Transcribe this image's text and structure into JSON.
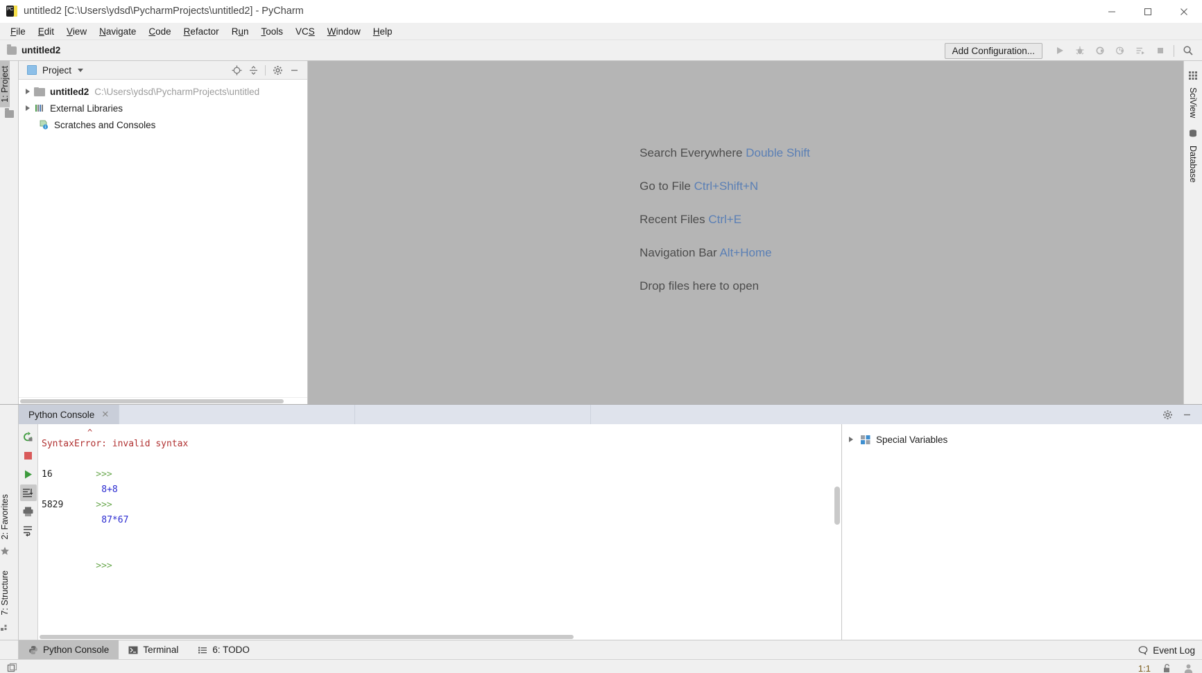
{
  "window": {
    "title": "untitled2 [C:\\Users\\ydsd\\PycharmProjects\\untitled2] - PyCharm",
    "app_icon": "pycharm-icon",
    "controls": {
      "minimize": "—",
      "maximize": "□",
      "close": "✕"
    }
  },
  "menubar": {
    "items": [
      {
        "label": "File",
        "mnemonic": "F"
      },
      {
        "label": "Edit",
        "mnemonic": "E"
      },
      {
        "label": "View",
        "mnemonic": "V"
      },
      {
        "label": "Navigate",
        "mnemonic": "N"
      },
      {
        "label": "Code",
        "mnemonic": "C"
      },
      {
        "label": "Refactor",
        "mnemonic": "R"
      },
      {
        "label": "Run",
        "mnemonic": "u"
      },
      {
        "label": "Tools",
        "mnemonic": "T"
      },
      {
        "label": "VCS",
        "mnemonic": "S"
      },
      {
        "label": "Window",
        "mnemonic": "W"
      },
      {
        "label": "Help",
        "mnemonic": "H"
      }
    ]
  },
  "navbar": {
    "breadcrumb": "untitled2",
    "folder_icon": "folder-icon",
    "add_configuration_label": "Add Configuration...",
    "toolbar_icons": [
      "run-icon",
      "debug-icon",
      "run-coverage-icon",
      "profile-icon",
      "run-with-params-icon",
      "stop-icon",
      "search-icon"
    ]
  },
  "left_rail": {
    "top_tabs": [
      {
        "label": "1: Project",
        "icon": "project-icon",
        "active": true
      }
    ],
    "bottom_tabs": [
      {
        "label": "2: Favorites",
        "icon": "star-icon"
      },
      {
        "label": "7: Structure",
        "icon": "structure-icon"
      }
    ]
  },
  "right_rail": {
    "tabs": [
      {
        "label": "SciView",
        "icon": "grid-icon"
      },
      {
        "label": "Database",
        "icon": "database-icon"
      }
    ]
  },
  "project_panel": {
    "title": "Project",
    "dropdown_icon": "chevron-down-icon",
    "actions": [
      "locate-icon",
      "collapse-all-icon",
      "gear-icon",
      "minimize-icon"
    ],
    "tree": [
      {
        "name": "untitled2",
        "path": "C:\\Users\\ydsd\\PycharmProjects\\untitled",
        "icon": "folder-icon",
        "expandable": true
      },
      {
        "name": "External Libraries",
        "path": "",
        "icon": "libraries-icon",
        "expandable": true
      },
      {
        "name": "Scratches and Consoles",
        "path": "",
        "icon": "scratches-icon",
        "expandable": false
      }
    ]
  },
  "editor": {
    "welcome_rows": [
      {
        "action": "Search Everywhere",
        "shortcut": "Double Shift"
      },
      {
        "action": "Go to File",
        "shortcut": "Ctrl+Shift+N"
      },
      {
        "action": "Recent Files",
        "shortcut": "Ctrl+E"
      },
      {
        "action": "Navigation Bar",
        "shortcut": "Alt+Home"
      },
      {
        "action": "Drop files here to open",
        "shortcut": ""
      }
    ]
  },
  "console": {
    "tab_label": "Python Console",
    "tab_close_icon": "close-icon",
    "header_actions": [
      "gear-icon",
      "minimize-icon"
    ],
    "toolstrip_icons": [
      "rerun-icon",
      "stop-icon",
      "execute-icon",
      "scroll-to-end-icon",
      "print-icon",
      "soft-wrap-icon"
    ],
    "lines": [
      {
        "type": "caret",
        "text": "^"
      },
      {
        "type": "error",
        "text": "SyntaxError: invalid syntax"
      },
      {
        "type": "input",
        "prompt": ">>>",
        "code": "8+8"
      },
      {
        "type": "output",
        "text": "16"
      },
      {
        "type": "input",
        "prompt": ">>>",
        "code": "87*67"
      },
      {
        "type": "output",
        "text": "5829"
      },
      {
        "type": "input",
        "prompt": ">>>",
        "code": ""
      }
    ],
    "variables": {
      "label": "Special Variables",
      "icon": "variables-icon",
      "expand_icon": "chevron-right-icon"
    }
  },
  "bottom_tools": {
    "tabs": [
      {
        "label": "Python Console",
        "icon": "python-icon",
        "active": true
      },
      {
        "label": "Terminal",
        "icon": "terminal-icon",
        "active": false
      },
      {
        "label": "6: TODO",
        "icon": "todo-icon",
        "active": false
      }
    ],
    "event_log": {
      "label": "Event Log",
      "icon": "balloon-icon"
    }
  },
  "statusbar": {
    "left_icon": "toggle-layout-icon",
    "position": "1:1",
    "lock_icon": "lock-open-icon",
    "user_icon": "person-icon"
  },
  "colors": {
    "accent_blue": "#2a2ad0",
    "prompt_green": "#6aa84f",
    "error_red": "#b03030",
    "shortcut_blue": "#5a7fb5",
    "editor_bg": "#b5b5b5",
    "chrome_bg": "#f0f0f0"
  }
}
